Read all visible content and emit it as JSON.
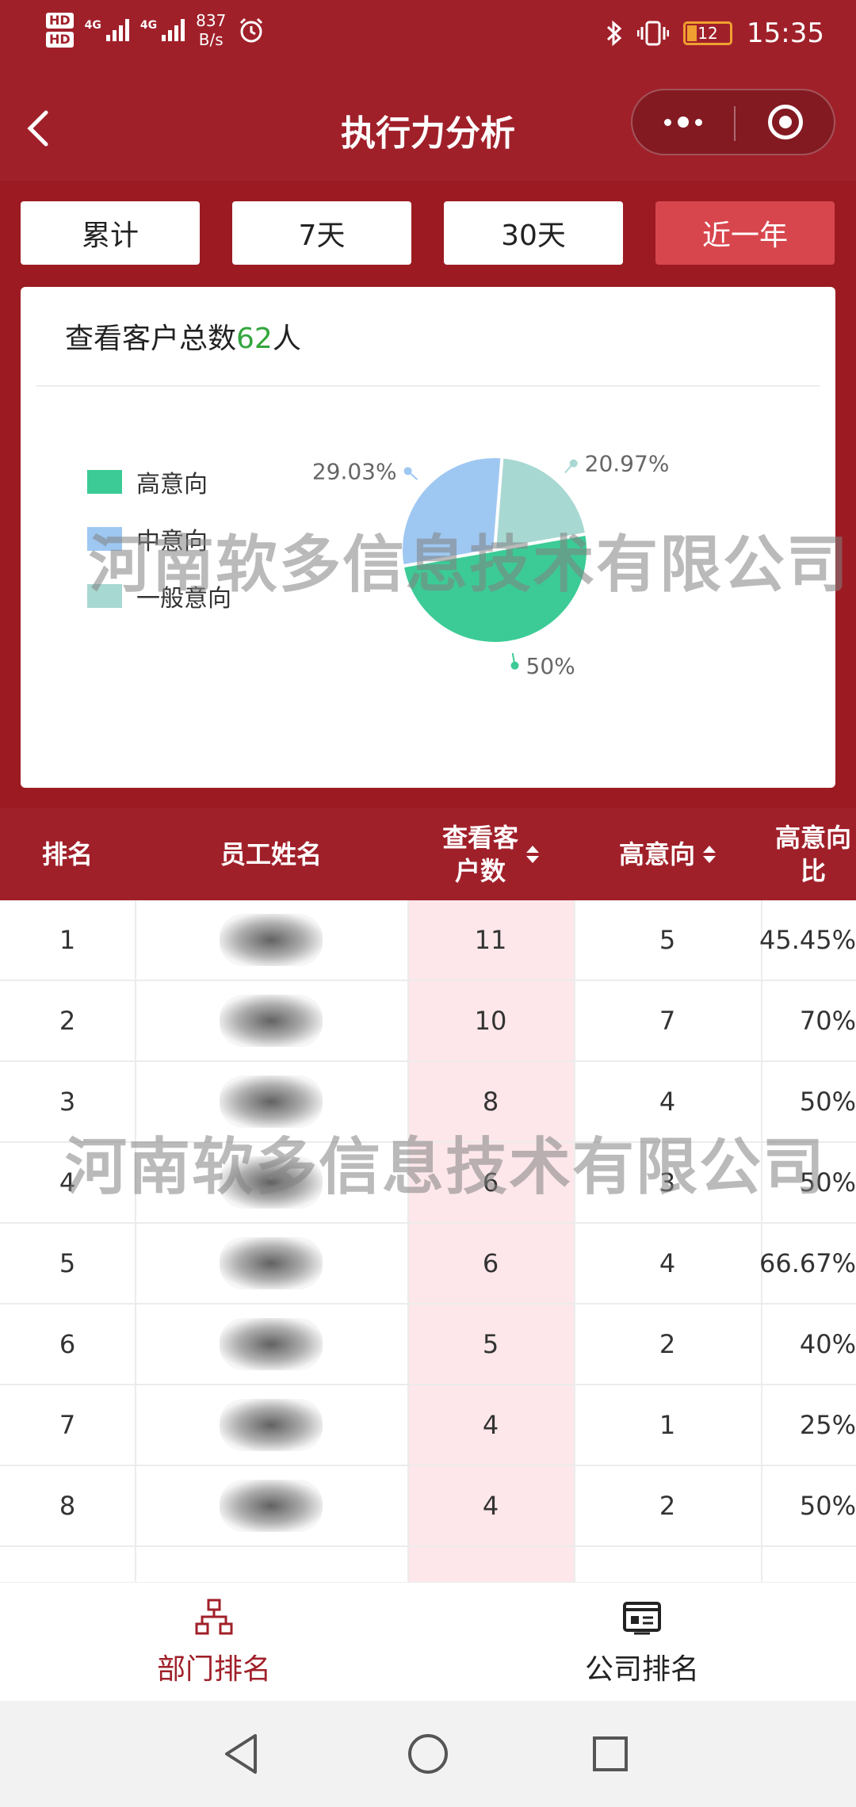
{
  "status_bar": {
    "hd1": "HD",
    "hd2": "HD",
    "net1": "4G",
    "net2": "4G",
    "speed_value": "837",
    "speed_unit": "B/s",
    "battery": "12",
    "time": "15:35"
  },
  "header": {
    "title": "执行力分析"
  },
  "tabs": [
    {
      "label": "累计"
    },
    {
      "label": "7天"
    },
    {
      "label": "30天"
    },
    {
      "label": "近一年"
    }
  ],
  "summary": {
    "prefix": "查看客户总数",
    "total": "62",
    "suffix": "人"
  },
  "chart_data": {
    "type": "pie",
    "series": [
      {
        "name": "高意向",
        "value": 50,
        "label": "50%",
        "color": "#3ccb96"
      },
      {
        "name": "中意向",
        "value": 29.03,
        "label": "29.03%",
        "color": "#9ec8f2"
      },
      {
        "name": "一般意向",
        "value": 20.97,
        "label": "20.97%",
        "color": "#a8d8d2"
      }
    ],
    "legend_position": "left"
  },
  "watermark": "河南软多信息技术有限公司",
  "table": {
    "headers": {
      "rank": "排名",
      "name": "员工姓名",
      "viewed_line1": "查看客",
      "viewed_line2": "户数",
      "high": "高意向",
      "ratio_line1": "高意向",
      "ratio_line2": "比"
    },
    "rows": [
      {
        "rank": "1",
        "viewed": "11",
        "high": "5",
        "ratio": "45.45%"
      },
      {
        "rank": "2",
        "viewed": "10",
        "high": "7",
        "ratio": "70%"
      },
      {
        "rank": "3",
        "viewed": "8",
        "high": "4",
        "ratio": "50%"
      },
      {
        "rank": "4",
        "viewed": "6",
        "high": "3",
        "ratio": "50%"
      },
      {
        "rank": "5",
        "viewed": "6",
        "high": "4",
        "ratio": "66.67%"
      },
      {
        "rank": "6",
        "viewed": "5",
        "high": "2",
        "ratio": "40%"
      },
      {
        "rank": "7",
        "viewed": "4",
        "high": "1",
        "ratio": "25%"
      },
      {
        "rank": "8",
        "viewed": "4",
        "high": "2",
        "ratio": "50%"
      }
    ]
  },
  "bottom_nav": {
    "dept": "部门排名",
    "company": "公司排名"
  },
  "colors": {
    "brand": "#a0202a",
    "active_tab": "#d8464d",
    "highlight_col": "#fde7ea",
    "total_number": "#33a63d"
  }
}
